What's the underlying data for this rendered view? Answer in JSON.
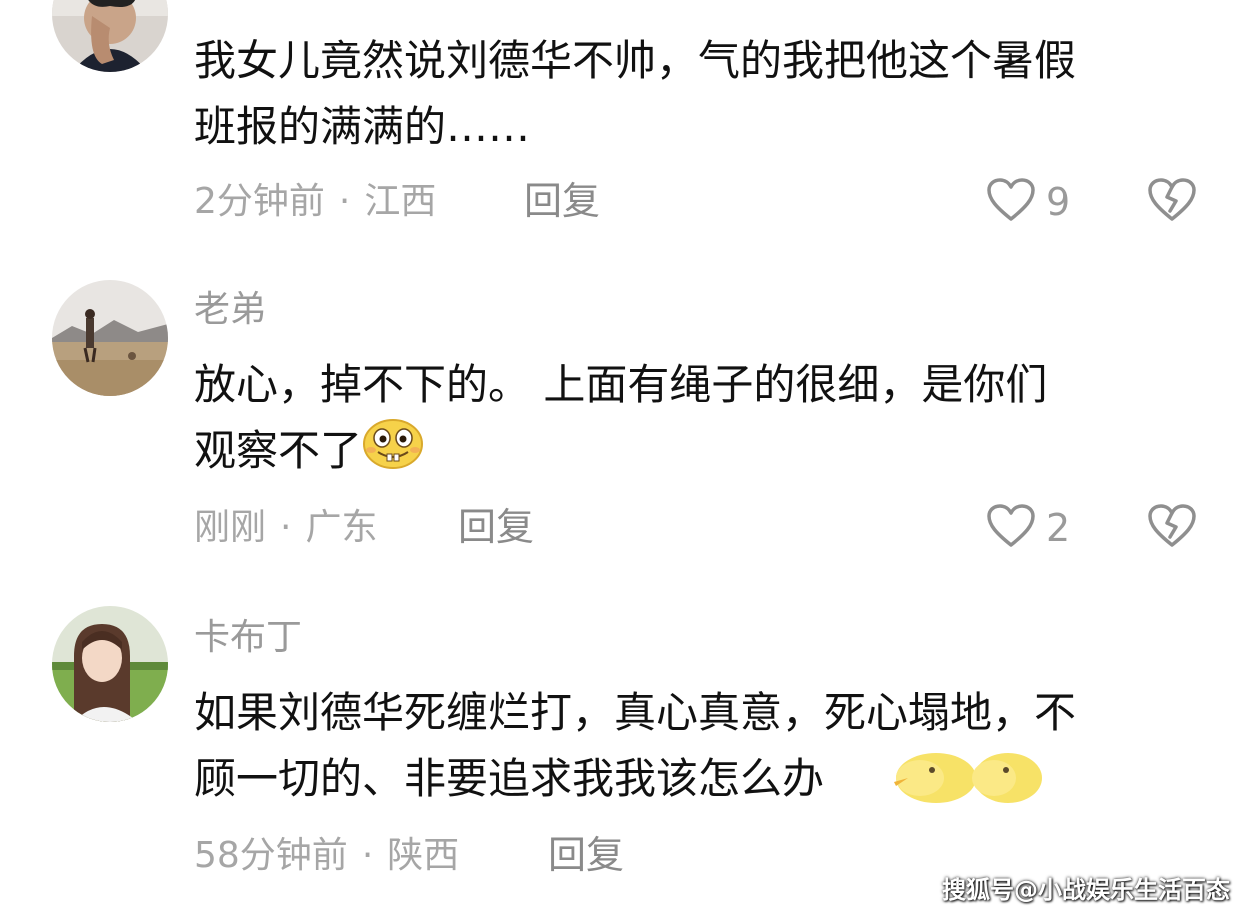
{
  "comments": [
    {
      "username": "",
      "lines": [
        "我女儿竟然说刘德华不帅，气的我把他这个暑假",
        "班报的满满的……"
      ],
      "time": "2分钟前",
      "separator": "·",
      "location": "江西",
      "reply_label": "回复",
      "likes": "9",
      "avatar_icon": "person-photo-avatar",
      "like_icon": "heart-outline-icon",
      "dislike_icon": "broken-heart-icon"
    },
    {
      "username": "老弟",
      "lines": [
        "放心，掉不下的。 上面有绳子的很细，是你们",
        "观察不了"
      ],
      "time": "刚刚",
      "separator": "·",
      "location": "广东",
      "reply_label": "回复",
      "likes": "2",
      "avatar_icon": "landscape-photo-avatar",
      "emoji_icon": "buck-teeth-grin-emoji",
      "like_icon": "heart-outline-icon",
      "dislike_icon": "broken-heart-icon"
    },
    {
      "username": "卡布丁",
      "lines": [
        "如果刘德华死缠烂打，真心真意，死心塌地，不",
        "顾一切的、非要追求我我该怎么办"
      ],
      "time": "58分钟前",
      "separator": "·",
      "location": "陕西",
      "reply_label": "回复",
      "avatar_icon": "girl-photo-avatar",
      "emoji_icon": "yellow-chick-emoji"
    }
  ],
  "watermark": "搜狐号@小战娱乐生活百态",
  "colors": {
    "text": "#111111",
    "secondary": "#a6a6a6",
    "icon": "#8f8f8f"
  }
}
